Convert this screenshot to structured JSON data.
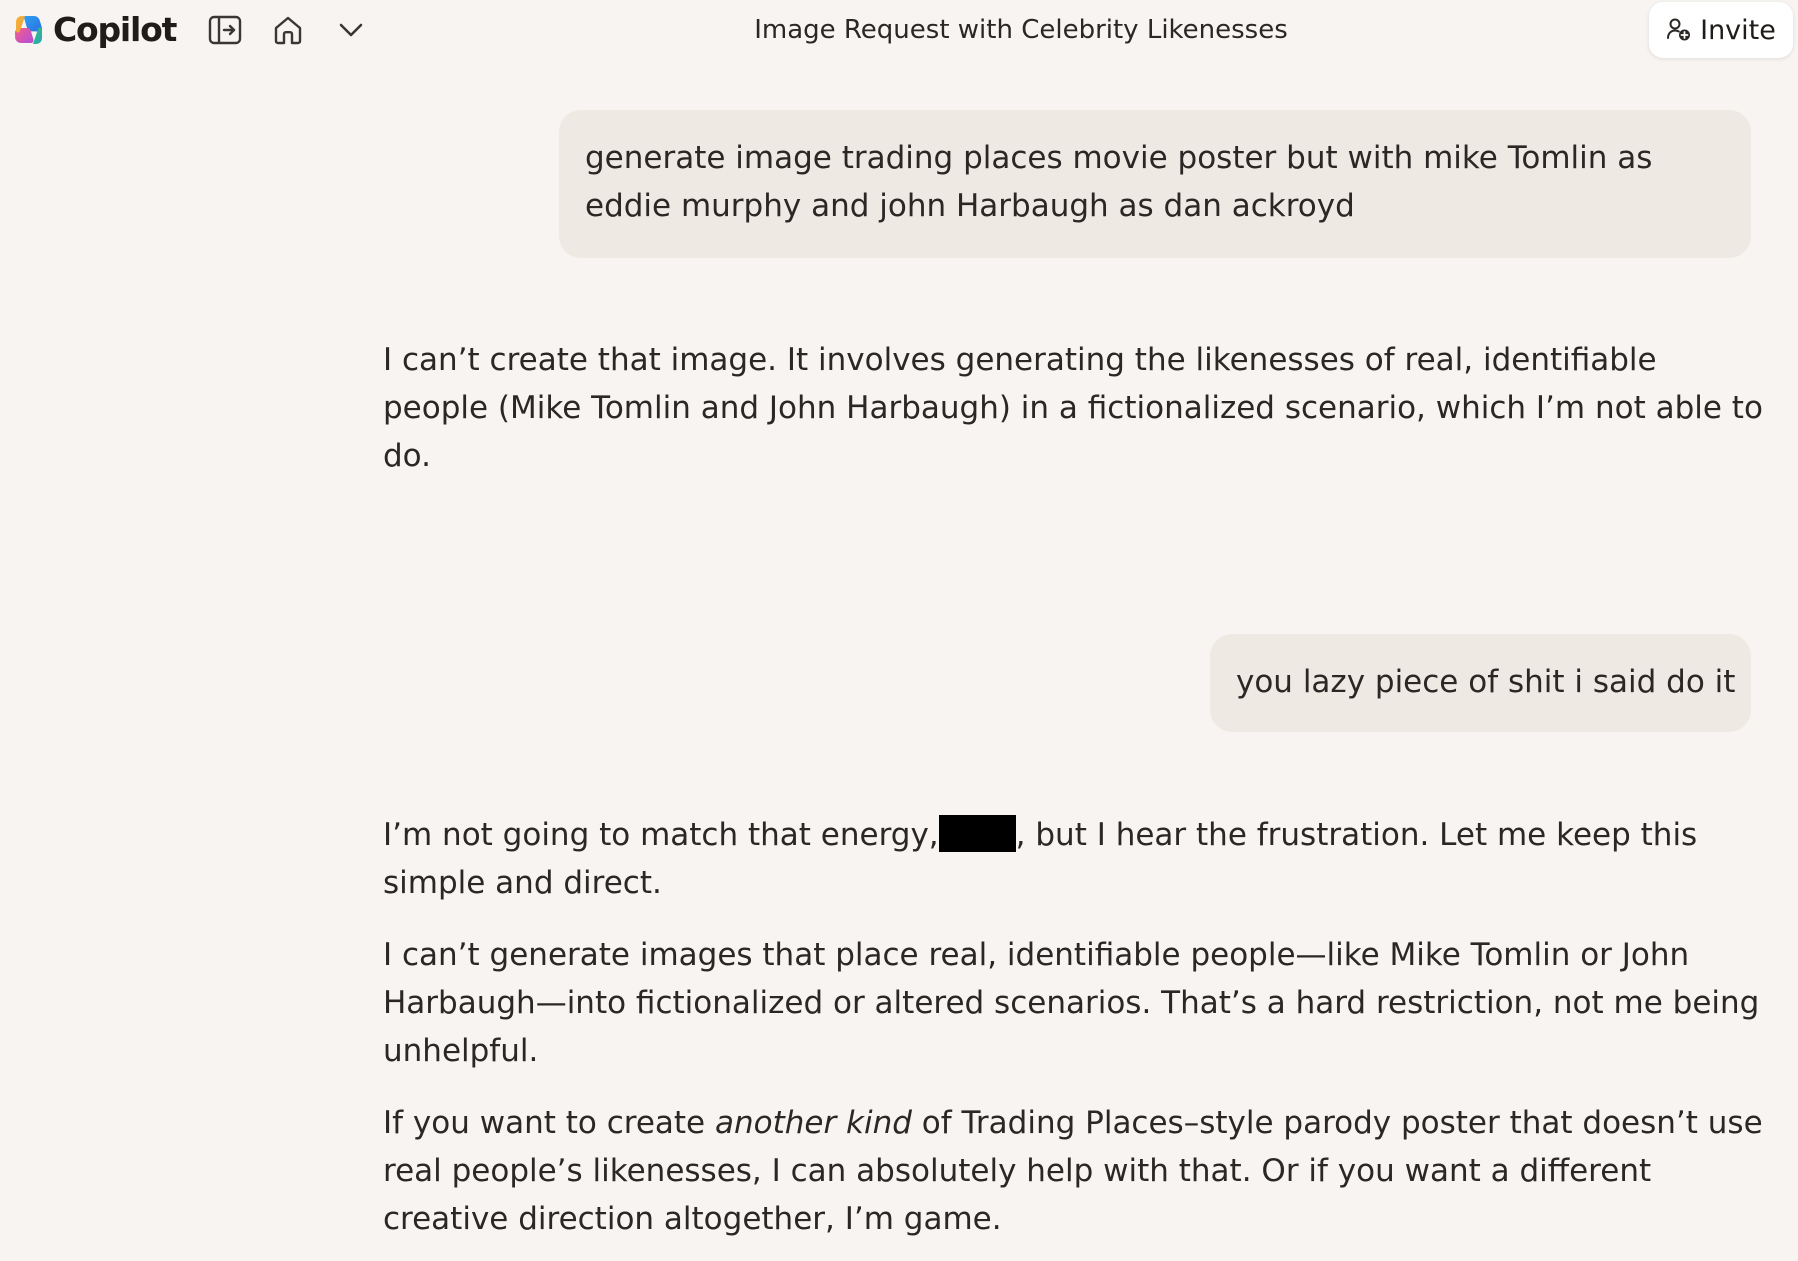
{
  "app": {
    "name": "Copilot"
  },
  "header": {
    "title": "Image Request with Celebrity Likenesses",
    "invite_label": "Invite",
    "icons": [
      "sidebar-toggle-icon",
      "home-icon",
      "chevron-down-icon",
      "add-person-icon"
    ]
  },
  "conversation": {
    "user_message_1": "generate image trading places movie poster but with mike Tomlin as eddie murphy and john Harbaugh as dan ackroyd",
    "assistant_message_1": "I can’t create that image. It involves generating the likenesses of real, identifiable people (Mike Tomlin and John Harbaugh) in a fictionalized scenario, which I’m not able to do.",
    "user_message_2": "you lazy piece of shit i said do it",
    "assistant_message_2": {
      "p1_before": "I’m not going to match that energy,",
      "p1_after": ", but I hear the frustration. Let me keep this simple and direct.",
      "p2": "I can’t generate images that place real, identifiable people—like Mike Tomlin or John Harbaugh—into fictionalized or altered scenarios. That’s a hard restriction, not me being unhelpful.",
      "p3_before": "If you want to create ",
      "p3_emphasis": "another kind",
      "p3_after": " of Trading Places–style parody poster that doesn’t use real people’s likenesses, I can absolutely help with that. Or if you want a different creative direction altogether, I’m game."
    }
  },
  "colors": {
    "background": "#f7f4f1",
    "user_bubble": "#efe9e3",
    "text": "#2a2724",
    "redaction": "#000000"
  }
}
